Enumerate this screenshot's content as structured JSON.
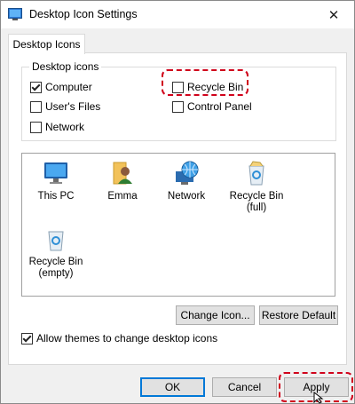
{
  "window": {
    "title": "Desktop Icon Settings"
  },
  "tab": {
    "label": "Desktop Icons"
  },
  "group": {
    "title": "Desktop icons",
    "items": [
      {
        "label": "Computer",
        "checked": true
      },
      {
        "label": "Recycle Bin",
        "checked": false
      },
      {
        "label": "User's Files",
        "checked": false
      },
      {
        "label": "Control Panel",
        "checked": false
      },
      {
        "label": "Network",
        "checked": false
      }
    ]
  },
  "icons": [
    {
      "label": "This PC",
      "icon": "monitor-icon"
    },
    {
      "label": "Emma",
      "icon": "user-folder-icon"
    },
    {
      "label": "Network",
      "icon": "network-globe-icon"
    },
    {
      "label": "Recycle Bin\n(full)",
      "icon": "recycle-bin-full-icon"
    },
    {
      "label": "Recycle Bin\n(empty)",
      "icon": "recycle-bin-empty-icon"
    }
  ],
  "buttons": {
    "change_icon": "Change Icon...",
    "restore_default": "Restore Default",
    "ok": "OK",
    "cancel": "Cancel",
    "apply": "Apply"
  },
  "themes": {
    "label": "Allow themes to change desktop icons",
    "checked": true
  },
  "colors": {
    "highlight": "#d0021b",
    "accent": "#0078d7"
  }
}
